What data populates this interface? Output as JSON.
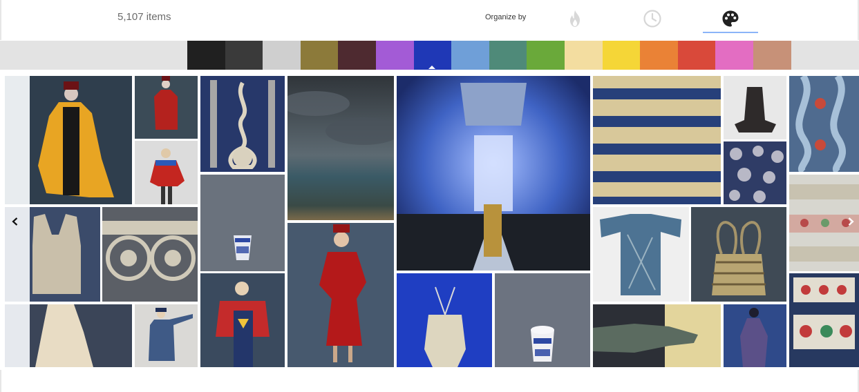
{
  "header": {
    "item_count": "5,107 items",
    "organize_label": "Organize by",
    "organize_options": [
      {
        "name": "popular",
        "icon": "flame-icon",
        "active": false
      },
      {
        "name": "time",
        "icon": "clock-icon",
        "active": false
      },
      {
        "name": "color",
        "icon": "palette-icon",
        "active": true
      }
    ]
  },
  "colors": {
    "accent": "#8ab4f8",
    "strip_background": "#e3e3e3",
    "swatches": [
      "#202020",
      "#3a3a3a",
      "#cfcfcf",
      "#8c7a3a",
      "#4e2a30",
      "#a35bd6",
      "#1f38b6",
      "#6f9fd8",
      "#4f8a79",
      "#6aa93a",
      "#f3dda0",
      "#f5d637",
      "#ea8236",
      "#d9493a",
      "#e36dc2",
      "#c79178"
    ],
    "selected_swatch_index": 6
  },
  "navigation": {
    "prev_icon": "chevron-left-icon",
    "next_icon": "chevron-right-icon"
  }
}
